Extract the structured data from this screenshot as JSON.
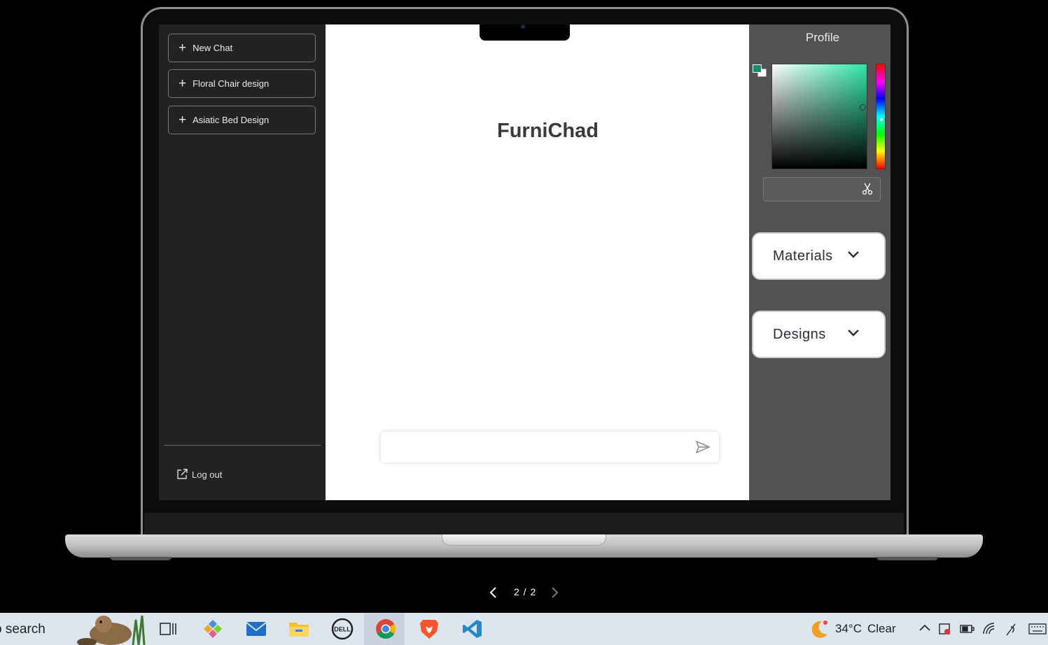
{
  "sidebar": {
    "items": [
      {
        "label": "New Chat"
      },
      {
        "label": "Floral Chair design"
      },
      {
        "label": "Asiatic Bed Design"
      }
    ],
    "logout_label": "Log out"
  },
  "main": {
    "title": "FurniChad",
    "chat_placeholder": ""
  },
  "right_panel": {
    "profile_label": "Profile",
    "color_picker": {
      "selected_color": "#1b8c6e",
      "hue_color": "#2ee6a6",
      "hex_value": ""
    },
    "dropdowns": [
      {
        "label": "Materials"
      },
      {
        "label": "Designs"
      }
    ]
  },
  "pager": {
    "text": "2 / 2"
  },
  "taskbar": {
    "search_text": "o search",
    "weather_temp": "34°C",
    "weather_desc": "Clear",
    "icons": [
      "task-view-icon",
      "pinned-app-icon",
      "mail-icon",
      "file-explorer-icon",
      "dell-icon",
      "chrome-icon",
      "brave-icon",
      "vscode-icon"
    ]
  }
}
